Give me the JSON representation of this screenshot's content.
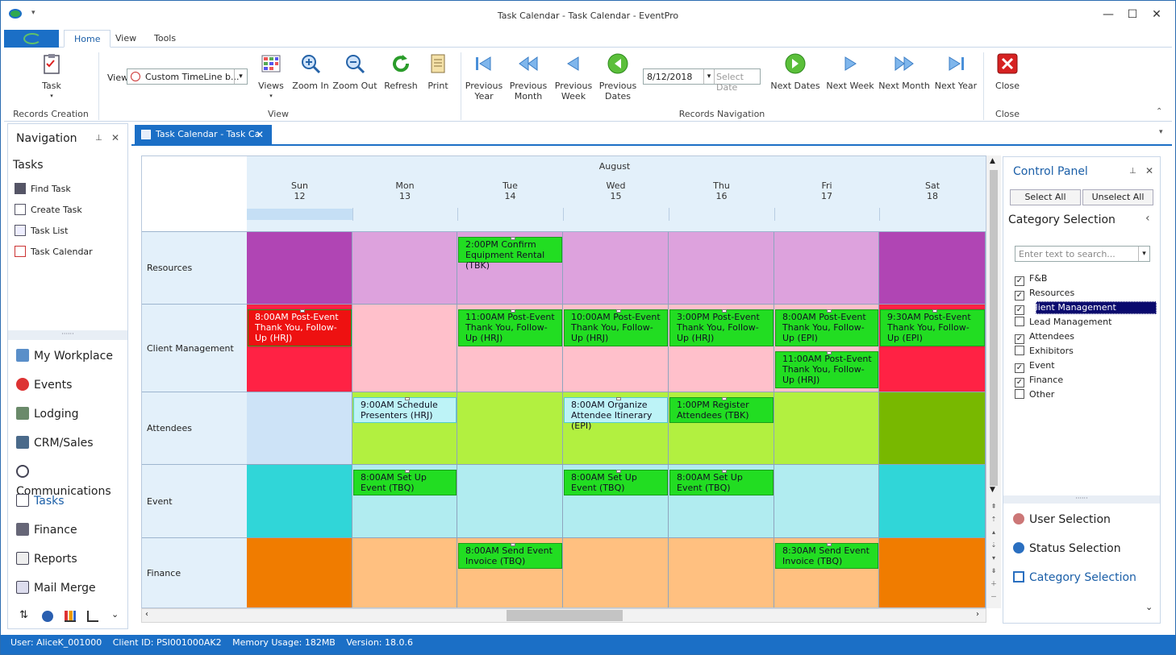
{
  "window": {
    "title": "Task Calendar - Task Calendar - EventPro"
  },
  "ribbon": {
    "tabs": [
      "Home",
      "View",
      "Tools"
    ],
    "active_tab": "Home",
    "task_label": "Task",
    "view_label": "View",
    "view_value": "Custom TimeLine b...",
    "buttons": [
      "Views",
      "Zoom In",
      "Zoom Out",
      "Refresh",
      "Print"
    ],
    "nav_buttons": [
      "Previous\nYear",
      "Previous\nMonth",
      "Previous\nWeek",
      "Previous\nDates"
    ],
    "date_value": "8/12/2018",
    "select_date": "Select Date",
    "next_buttons": [
      "Next Dates",
      "Next Week",
      "Next Month",
      "Next Year"
    ],
    "close_label": "Close",
    "groups": [
      "Records Creation",
      "View",
      "Records Navigation",
      "Close"
    ]
  },
  "navigation": {
    "title": "Navigation",
    "section": "Tasks",
    "task_links": [
      "Find Task",
      "Create Task",
      "Task List",
      "Task Calendar"
    ],
    "modules": [
      "My Workplace",
      "Events",
      "Lodging",
      "CRM/Sales",
      "Communications",
      "Tasks",
      "Finance",
      "Reports",
      "Mail Merge"
    ]
  },
  "doc_tab": {
    "label": "Task Calendar - Task Ca"
  },
  "calendar": {
    "month": "August",
    "days": [
      {
        "name": "Sun",
        "num": "12"
      },
      {
        "name": "Mon",
        "num": "13"
      },
      {
        "name": "Tue",
        "num": "14"
      },
      {
        "name": "Wed",
        "num": "15"
      },
      {
        "name": "Thu",
        "num": "16"
      },
      {
        "name": "Fri",
        "num": "17"
      },
      {
        "name": "Sat",
        "num": "18"
      }
    ],
    "rows": [
      "Resources",
      "Client Management",
      "Attendees",
      "Event",
      "Finance"
    ],
    "appointments": [
      {
        "text": "2:00PM Confirm Equipment Rental (TBK)"
      },
      {
        "text": "8:00AM Post-Event Thank You, Follow-Up (HRJ)"
      },
      {
        "text": "11:00AM Post-Event Thank You, Follow-Up (HRJ)"
      },
      {
        "text": "10:00AM Post-Event Thank You, Follow-Up (HRJ)"
      },
      {
        "text": "3:00PM Post-Event Thank You, Follow-Up (HRJ)"
      },
      {
        "text": "8:00AM Post-Event Thank You, Follow-Up (EPI)"
      },
      {
        "text": "9:30AM Post-Event Thank You, Follow-Up (EPI)"
      },
      {
        "text": "11:00AM Post-Event Thank You, Follow-Up (HRJ)"
      },
      {
        "text": "9:00AM Schedule Presenters (HRJ)"
      },
      {
        "text": "8:00AM Organize Attendee Itinerary (EPI)"
      },
      {
        "text": "1:00PM Register Attendees (TBK)"
      },
      {
        "text": "8:00AM Set Up Event (TBQ)"
      },
      {
        "text": "8:00AM Set Up Event (TBQ)"
      },
      {
        "text": "8:00AM Set Up Event (TBQ)"
      },
      {
        "text": "8:00AM Send Event Invoice (TBQ)"
      },
      {
        "text": "8:30AM Send Event Invoice (TBQ)"
      }
    ]
  },
  "control_panel": {
    "title": "Control Panel",
    "select_all": "Select All",
    "unselect_all": "Unselect All",
    "category_title": "Category Selection",
    "search_placeholder": "Enter text to search...",
    "categories": [
      {
        "label": "F&B",
        "checked": true
      },
      {
        "label": "Resources",
        "checked": true
      },
      {
        "label": "Client Management",
        "checked": true
      },
      {
        "label": "Lead Management",
        "checked": false
      },
      {
        "label": "Attendees",
        "checked": true
      },
      {
        "label": "Exhibitors",
        "checked": false
      },
      {
        "label": "Event",
        "checked": true
      },
      {
        "label": "Finance",
        "checked": true
      },
      {
        "label": "Other",
        "checked": false
      }
    ],
    "links": [
      "User Selection",
      "Status Selection",
      "Category Selection"
    ]
  },
  "status_bar": {
    "user": "User: AliceK_001000",
    "client": "Client ID: PSI001000AK2",
    "memory": "Memory Usage: 182MB",
    "version": "Version: 18.0.6"
  },
  "colors": {
    "accent": "#1b6fc6",
    "appt_green": "#22dd22",
    "appt_red": "#ee1111"
  }
}
